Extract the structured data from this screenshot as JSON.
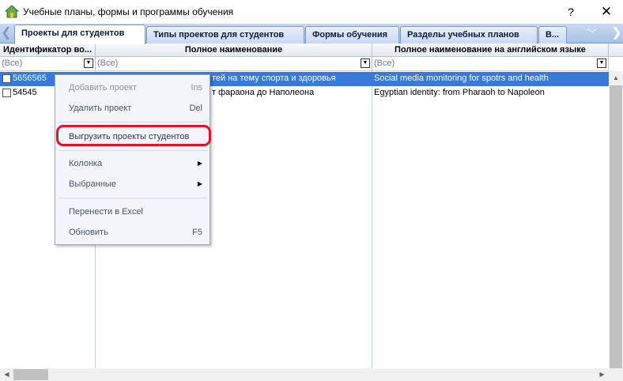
{
  "window": {
    "title": "Учебные планы, формы и программы обучения",
    "help_label": "?",
    "close_label": "✕"
  },
  "tabs": [
    {
      "label": "Проекты для студентов",
      "active": true
    },
    {
      "label": "Типы проектов для студентов",
      "active": false
    },
    {
      "label": "Формы обучения",
      "active": false
    },
    {
      "label": "Разделы учебных планов",
      "active": false
    },
    {
      "label": "В...",
      "active": false
    }
  ],
  "grid": {
    "columns": [
      {
        "header": "Идентификатор во...",
        "filter": "(Все)"
      },
      {
        "header": "Полное наименование",
        "filter": "(Все)"
      },
      {
        "header": "Полное наименование на английском языке",
        "filter": "(Все)"
      }
    ],
    "rows": [
      {
        "id": "5656565",
        "name_visible": "тей на тему спорта и здоровья",
        "name_en": "Social media monitoring for spotrs and health",
        "selected": true
      },
      {
        "id": "54545",
        "name_visible": "т фараона до Наполеона",
        "name_en": "Egyptian identity: from Pharaoh to Napoleon",
        "selected": false
      }
    ]
  },
  "context_menu": {
    "items": [
      {
        "label": "Добавить проект",
        "shortcut": "Ins"
      },
      {
        "label": "Удалить проект",
        "shortcut": "Del"
      },
      {
        "label": "Выгрузить проекты студентов",
        "shortcut": ""
      },
      {
        "label": "Колонка",
        "shortcut": ""
      },
      {
        "label": "Выбранные",
        "shortcut": ""
      },
      {
        "label": "Перенести в Excel",
        "shortcut": ""
      },
      {
        "label": "Обновить",
        "shortcut": "F5"
      }
    ]
  },
  "colors": {
    "selection": "#3879d9",
    "tab_bar": "#aac2e6",
    "highlight": "#e3122b"
  }
}
